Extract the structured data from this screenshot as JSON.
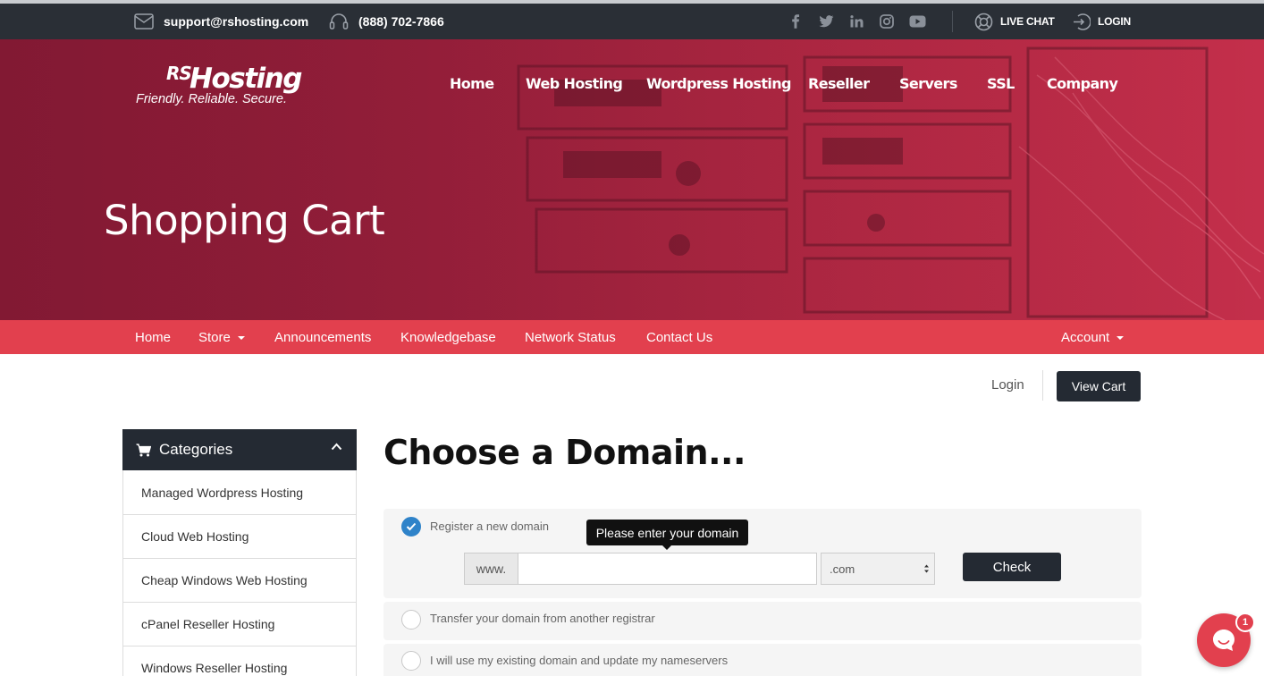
{
  "topbar": {
    "email": "support@rshosting.com",
    "phone": "(888) 702-7866",
    "social_icons": [
      "facebook-icon",
      "twitter-icon",
      "linkedin-icon",
      "instagram-icon",
      "youtube-icon"
    ],
    "live_chat": "LIVE CHAT",
    "login": "LOGIN"
  },
  "brand": {
    "logo_rs": "RS",
    "logo_name": "Hosting",
    "tagline": "Friendly. Reliable. Secure."
  },
  "main_nav": [
    "Home",
    "Web Hosting",
    "Wordpress Hosting",
    "Reseller",
    "Servers",
    "SSL",
    "Company"
  ],
  "hero": {
    "title": "Shopping Cart"
  },
  "sub_nav": {
    "items": [
      "Home",
      "Store",
      "Announcements",
      "Knowledgebase",
      "Network Status",
      "Contact Us"
    ],
    "account": "Account"
  },
  "cart_actions": {
    "login": "Login",
    "view_cart": "View Cart"
  },
  "sidebar": {
    "title": "Categories",
    "items": [
      "Managed Wordpress Hosting",
      "Cloud Web Hosting",
      "Cheap Windows Web Hosting",
      "cPanel Reseller Hosting",
      "Windows Reseller Hosting"
    ]
  },
  "main": {
    "heading": "Choose a Domain...",
    "options": [
      {
        "label": "Register a new domain",
        "selected": true
      },
      {
        "label": "Transfer your domain from another registrar",
        "selected": false
      },
      {
        "label": "I will use my existing domain and update my nameservers",
        "selected": false
      }
    ],
    "www_prefix": "www.",
    "domain_value": "",
    "tld_selected": ".com",
    "check_button": "Check",
    "tooltip": "Please enter your domain"
  },
  "chat_widget": {
    "badge_count": "1"
  },
  "colors": {
    "dark": "#242a33",
    "accent_red": "#e2404e",
    "hero_crimson": "#a1233f",
    "radio_blue": "#2f83c9"
  }
}
